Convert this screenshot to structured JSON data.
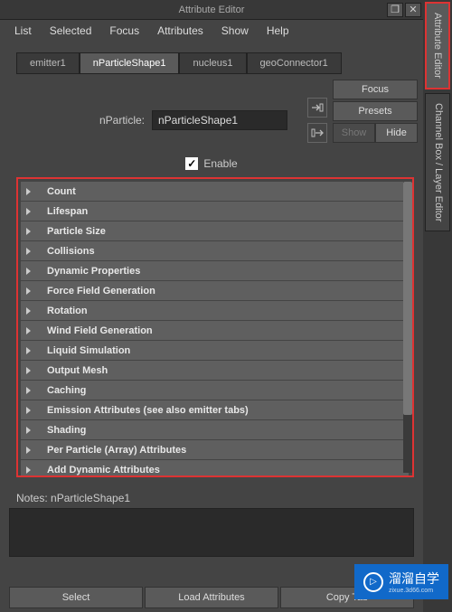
{
  "title": "Attribute Editor",
  "menu": [
    "List",
    "Selected",
    "Focus",
    "Attributes",
    "Show",
    "Help"
  ],
  "tabs": [
    "emitter1",
    "nParticleShape1",
    "nucleus1",
    "geoConnector1"
  ],
  "active_tab": 1,
  "side_tabs": [
    "Attribute Editor",
    "Channel Box / Layer Editor"
  ],
  "active_side_tab": 0,
  "node": {
    "label": "nParticle:",
    "value": "nParticleShape1"
  },
  "right_buttons": {
    "focus": "Focus",
    "presets": "Presets",
    "show": "Show",
    "hide": "Hide"
  },
  "enable": {
    "label": "Enable",
    "checked": true
  },
  "sections": [
    "Count",
    "Lifespan",
    "Particle Size",
    "Collisions",
    "Dynamic Properties",
    "Force Field Generation",
    "Rotation",
    "Wind Field Generation",
    "Liquid Simulation",
    "Output Mesh",
    "Caching",
    "Emission Attributes (see also emitter tabs)",
    "Shading",
    "Per Particle (Array) Attributes",
    "Add Dynamic Attributes"
  ],
  "notes": {
    "label": "Notes:  nParticleShape1"
  },
  "bottom": {
    "select": "Select",
    "load": "Load Attributes",
    "copy": "Copy Tab"
  },
  "watermark": {
    "text": "溜溜自学",
    "sub": "zixue.3d66.com"
  }
}
